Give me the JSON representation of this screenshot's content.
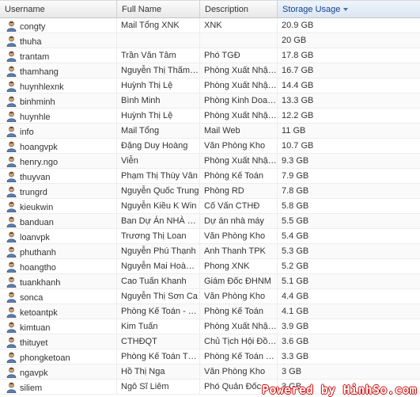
{
  "columns": {
    "username": "Username",
    "fullname": "Full Name",
    "description": "Description",
    "storage": "Storage Usage"
  },
  "rows": [
    {
      "username": "congty",
      "fullname": "Mail Tổng XNK",
      "description": "XNK",
      "storage": "20.9 GB"
    },
    {
      "username": "thuha",
      "fullname": "",
      "description": "",
      "storage": "20 GB"
    },
    {
      "username": "trantam",
      "fullname": "Trần Văn Tâm",
      "description": "Phó TGĐ",
      "storage": "17.8 GB"
    },
    {
      "username": "thamhang",
      "fullname": "Nguyễn Thị Thấm Hằng",
      "description": "Phòng Xuất Nhập Khẩu",
      "storage": "16.7 GB"
    },
    {
      "username": "huynhlexnk",
      "fullname": "Huỳnh Thị Lệ",
      "description": "Phòng Xuất Nhập Khẩu",
      "storage": "14.4 GB"
    },
    {
      "username": "binhminh",
      "fullname": "Bình Minh",
      "description": "Phòng Kinh Doanh",
      "storage": "13.3 GB"
    },
    {
      "username": "huynhle",
      "fullname": "Huỳnh Thị Lệ",
      "description": "Phòng Xuất Nhập Khẩu",
      "storage": "12.2 GB"
    },
    {
      "username": "info",
      "fullname": "Mail Tổng",
      "description": "Mail Web",
      "storage": "11 GB"
    },
    {
      "username": "hoangvpk",
      "fullname": "Đặng Duy Hoàng",
      "description": "Văn Phòng Kho",
      "storage": "10.7 GB"
    },
    {
      "username": "henry.ngo",
      "fullname": "Viễn",
      "description": "Phòng Xuất Nhập Khẩu",
      "storage": "9.3 GB"
    },
    {
      "username": "thuyvan",
      "fullname": "Phạm Thị Thùy Vân",
      "description": "Phòng Kế Toán",
      "storage": "7.9 GB"
    },
    {
      "username": "trungrd",
      "fullname": "Nguyễn Quốc Trung",
      "description": "Phòng RD",
      "storage": "7.8 GB"
    },
    {
      "username": "kieukwin",
      "fullname": "Nguyễn Kiều K Win",
      "description": "Cố Vấn CTHĐ",
      "storage": "5.8 GB"
    },
    {
      "username": "banduan",
      "fullname": "Ban Dự Án NHÀ MÁY",
      "description": "Dự án nhà máy",
      "storage": "5.5 GB"
    },
    {
      "username": "loanvpk",
      "fullname": "Trương Thị Loan",
      "description": "Văn Phòng Kho",
      "storage": "5.4 GB"
    },
    {
      "username": "phuthanh",
      "fullname": "Nguyễn Phú Thạnh",
      "description": "Anh Thanh TPK",
      "storage": "5.3 GB"
    },
    {
      "username": "hoangtho",
      "fullname": "Nguyễn Mai Hoàng Thọ",
      "description": "Phong XNK",
      "storage": "5.2 GB"
    },
    {
      "username": "tuankhanh",
      "fullname": "Cao Tuấn Khanh",
      "description": "Giám Đốc ĐHNM",
      "storage": "5.1 GB"
    },
    {
      "username": "sonca",
      "fullname": "Nguyễn Thị Sơn Ca",
      "description": "Văn Phòng Kho",
      "storage": "4.4 GB"
    },
    {
      "username": "ketoantpk",
      "fullname": "Phòng Kế Toán - TPK",
      "description": "Phòng Kế Toán",
      "storage": "4.1 GB"
    },
    {
      "username": "kimtuan",
      "fullname": "Kim Tuấn",
      "description": "Phòng Xuất Nhập Khẩu",
      "storage": "3.9 GB"
    },
    {
      "username": "thituyet",
      "fullname": "CTHĐQT",
      "description": "Chủ Tịch Hội Đồng Quản Trị",
      "storage": "3.6 GB"
    },
    {
      "username": "phongketoan",
      "fullname": "Phòng Kế Toán TPK",
      "description": "Phòng Kế Toán TPK",
      "storage": "3.3 GB"
    },
    {
      "username": "ngavpk",
      "fullname": "Hồ Thị Nga",
      "description": "Văn Phòng Kho",
      "storage": "3 GB"
    },
    {
      "username": "siliem",
      "fullname": "Ngô Sĩ Liêm",
      "description": "Phó Quản Đốc Nhà Máy",
      "storage": "3 GB"
    }
  ],
  "row_icon": "user-icon",
  "watermark": "Powered by HinhSo.com",
  "colors": {
    "sorted_header": "#15428b",
    "watermark": "#cc0000"
  }
}
